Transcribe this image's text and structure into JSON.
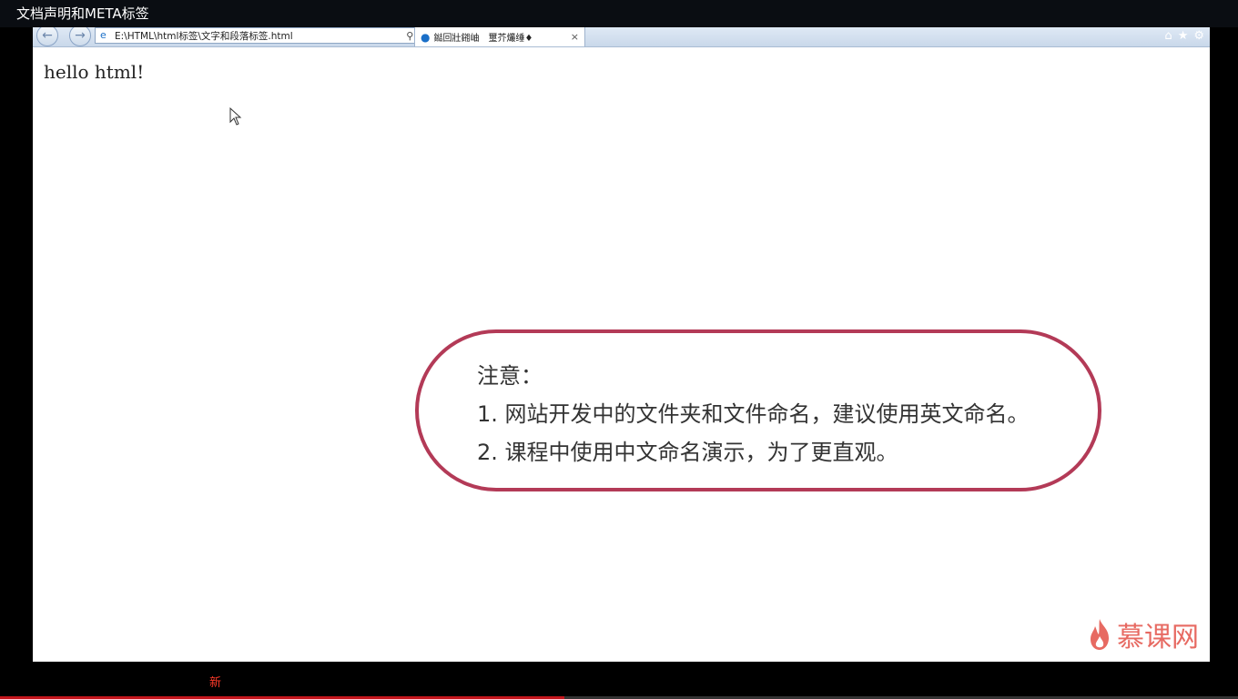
{
  "player": {
    "title": "文档声明和META标签",
    "bottom_label": "新",
    "progress_fraction": 0.456
  },
  "browser": {
    "url": "E:\\HTML\\html标签\\文字和段落标签.html",
    "tab_label": "鐑回壯鎺岫　璽芥爜缍♦",
    "tab_close": "×",
    "icons": [
      "back-icon",
      "forward-icon",
      "search-icon",
      "refresh-icon",
      "home-icon",
      "star-icon",
      "gear-icon"
    ]
  },
  "page": {
    "text": "hello html!"
  },
  "note": {
    "heading": "注意：",
    "line1": "1. 网站开发中的文件夹和文件命名，建议使用英文命名。",
    "line2": "2. 课程中使用中文命名演示，为了更直观。"
  },
  "logo": {
    "text": "慕课网",
    "color": "#e76a62"
  },
  "colors": {
    "note_border": "#b33a57",
    "progress": "#c4151c"
  }
}
